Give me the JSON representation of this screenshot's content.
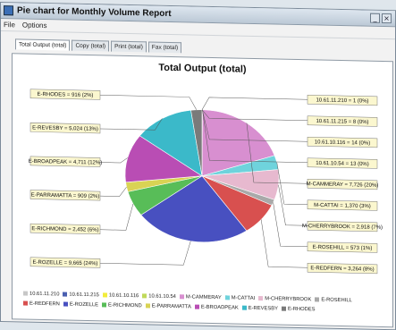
{
  "window": {
    "title": "Pie chart for Monthly Volume Report"
  },
  "menu": [
    "File",
    "Options"
  ],
  "tabs": [
    "Total Output (total)",
    "Copy (total)",
    "Print (total)",
    "Fax (total)"
  ],
  "active_tab": 0,
  "colors": {
    "10.61.11.210": "#c7c7c7",
    "10.61.11.215": "#4a5fb0",
    "10.61.10.116": "#f2ec3c",
    "10.61.10.54": "#c0d95a",
    "M-CAMMERAY": "#d88fd0",
    "M-CATTAI": "#6fd3dc",
    "M-CHERRYBROOK": "#e7b9cf",
    "E-ROSEHILL": "#a9a9a9",
    "E-REDFERN": "#d8504f",
    "E-ROZELLE": "#4850c0",
    "E-RICHMOND": "#58bd58",
    "E-PARRAMATTA": "#d9d354",
    "E-BROADPEAK": "#b94db4",
    "E-REVESBY": "#3bb9c9",
    "E-RHODES": "#7a7a7a"
  },
  "chart_data": {
    "type": "pie",
    "title": "Total Output (total)",
    "slices": [
      {
        "name": "10.61.11.210",
        "value": 1,
        "label": "10.61.11.210 = 1 (0%)"
      },
      {
        "name": "10.61.11.215",
        "value": 8,
        "label": "10.61.11.215 = 8 (0%)"
      },
      {
        "name": "10.61.10.116",
        "value": 14,
        "label": "10.61.10.116 = 14 (0%)"
      },
      {
        "name": "10.61.10.54",
        "value": 13,
        "label": "10.61.10.54 = 13 (0%)"
      },
      {
        "name": "M-CAMMERAY",
        "value": 7726,
        "label": "M-CAMMERAY = 7,726 (20%)"
      },
      {
        "name": "M-CATTAI",
        "value": 1370,
        "label": "M-CATTAI = 1,370 (3%)"
      },
      {
        "name": "M-CHERRYBROOK",
        "value": 2918,
        "label": "M-CHERRYBROOK = 2,918 (7%)"
      },
      {
        "name": "E-ROSEHILL",
        "value": 573,
        "label": "E-ROSEHILL = 573 (1%)"
      },
      {
        "name": "E-REDFERN",
        "value": 3264,
        "label": "E-REDFERN = 3,264 (8%)"
      },
      {
        "name": "E-ROZELLE",
        "value": 9665,
        "label": "E-ROZELLE = 9,665 (24%)"
      },
      {
        "name": "E-RICHMOND",
        "value": 2452,
        "label": "E-RICHMOND = 2,452 (6%)"
      },
      {
        "name": "E-PARRAMATTA",
        "value": 909,
        "label": "E-PARRAMATTA = 909 (2%)"
      },
      {
        "name": "E-BROADPEAK",
        "value": 4711,
        "label": "E-BROADPEAK = 4,711 (12%)"
      },
      {
        "name": "E-REVESBY",
        "value": 5024,
        "label": "E-REVESBY = 5,024 (13%)"
      },
      {
        "name": "E-RHODES",
        "value": 916,
        "label": "E-RHODES = 916 (2%)"
      }
    ],
    "legend_position": "bottom"
  }
}
